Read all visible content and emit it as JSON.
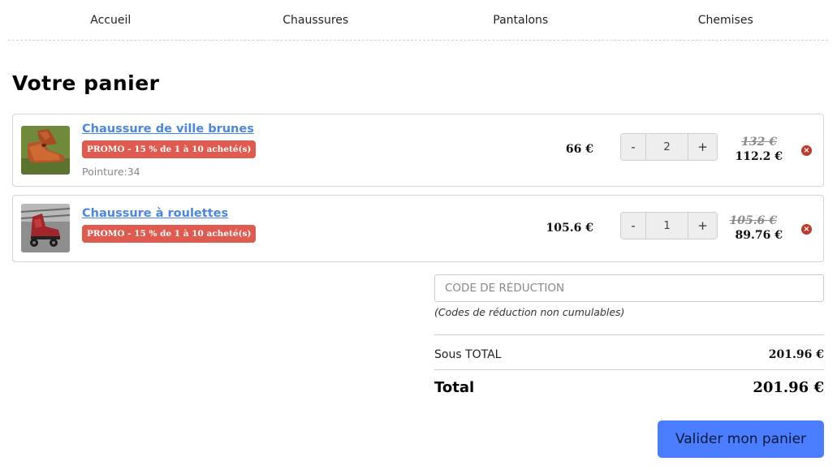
{
  "nav": {
    "items": [
      {
        "label": "Accueil"
      },
      {
        "label": "Chaussures"
      },
      {
        "label": "Pantalons"
      },
      {
        "label": "Chemises"
      }
    ]
  },
  "page": {
    "title": "Votre panier"
  },
  "cart": {
    "items": [
      {
        "name": "Chaussure de ville brunes",
        "promo": "PROMO - 15 % de 1 à 10 acheté(s)",
        "attribute": "Pointure:34",
        "unit_price": "66 €",
        "quantity": "2",
        "old_price": "132 €",
        "new_price": "112.2 €",
        "image_icon": "brown-shoe-photo"
      },
      {
        "name": "Chaussure à roulettes",
        "promo": "PROMO - 15 % de 1 à 10 acheté(s)",
        "unit_price": "105.6 €",
        "quantity": "1",
        "old_price": "105.6 €",
        "new_price": "89.76 €",
        "image_icon": "roller-skate-photo"
      }
    ],
    "qty_minus": "-",
    "qty_plus": "+",
    "remove_icon": "remove-circle-icon"
  },
  "discount": {
    "placeholder": "CODE DE RÉDUCTION",
    "note": "(Codes de réduction non cumulables)"
  },
  "summary": {
    "subtotal_label": "Sous TOTAL",
    "subtotal_value": "201.96 €",
    "total_label": "Total",
    "total_value": "201.96 €"
  },
  "actions": {
    "validate_label": "Valider mon panier"
  },
  "colors": {
    "link": "#4a86e8",
    "promo": "#e05a4f",
    "remove": "#c0392b",
    "primary_button": "#4a7dff"
  }
}
